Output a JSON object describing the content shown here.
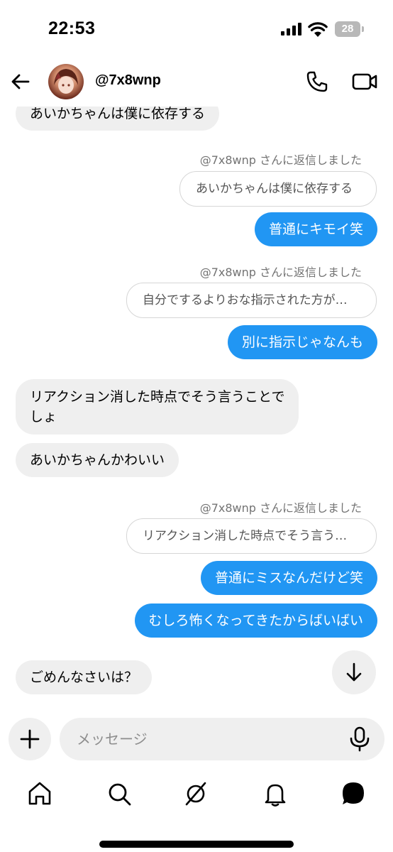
{
  "status_bar": {
    "time": "22:53",
    "battery": "28"
  },
  "header": {
    "username": "@7x8wnp"
  },
  "messages": [
    {
      "type": "incoming",
      "text": "あいかちゃんは僕に依存する"
    },
    {
      "type": "outgoing",
      "reply_meta": "@7x8wnp さんに返信しました",
      "reply_quote": "あいかちゃんは僕に依存する",
      "text": "普通にキモイ笑"
    },
    {
      "type": "outgoing",
      "reply_meta": "@7x8wnp さんに返信しました",
      "reply_quote": "自分でするよりおな指示された方が…",
      "text": "別に指示じゃなんも"
    },
    {
      "type": "incoming",
      "line1": "リアクション消した時点でそう言うことで",
      "line2": "しょ"
    },
    {
      "type": "incoming",
      "text": "あいかちゃんかわいい"
    },
    {
      "type": "outgoing",
      "reply_meta": "@7x8wnp さんに返信しました",
      "reply_quote": "リアクション消した時点でそう言う…",
      "text": "普通にミスなんだけど笑"
    },
    {
      "type": "outgoing",
      "text": "むしろ怖くなってきたからばいばい"
    },
    {
      "type": "incoming",
      "text": "ごめんなさいは？"
    }
  ],
  "composer": {
    "placeholder": "メッセージ"
  },
  "nav": [
    "home-icon",
    "search-icon",
    "explore-icon",
    "notifications-icon",
    "messages-icon"
  ],
  "colors": {
    "outgoing_bubble": "#2196f3",
    "incoming_bubble": "#efefef"
  }
}
